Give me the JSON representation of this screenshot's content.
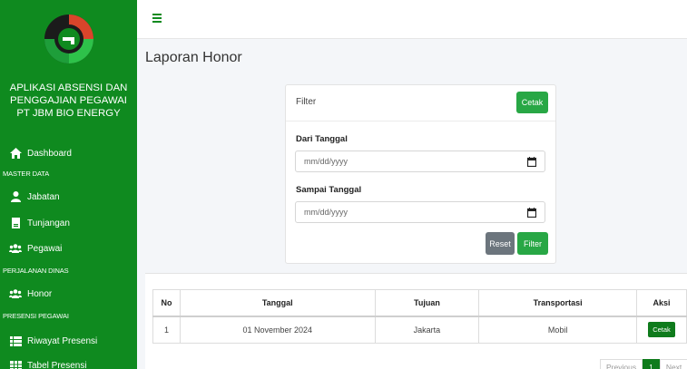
{
  "app": {
    "brand_lines": [
      "APLIKASI ABSENSI DAN",
      "PENGGAJIAN PEGAWAI",
      "PT JBM BIO ENERGY"
    ]
  },
  "sidebar": {
    "dashboard": "Dashboard",
    "section_master": "MASTER DATA",
    "jabatan": "Jabatan",
    "tunjangan": "Tunjangan",
    "pegawai": "Pegawai",
    "section_perjalanan": "PERJALANAN DINAS",
    "honor": "Honor",
    "section_presensi": "PRESENSI PEGAWAI",
    "riwayat": "Riwayat Presensi",
    "tabel": "Tabel Presensi"
  },
  "page": {
    "title": "Laporan Honor"
  },
  "filter_card": {
    "title": "Filter",
    "cetak_label": "Cetak",
    "dari_label": "Dari Tanggal",
    "dari_placeholder": "mm/dd/yyyy",
    "sampai_label": "Sampai Tanggal",
    "sampai_placeholder": "mm/dd/yyyy",
    "reset_label": "Reset",
    "filter_label": "Filter"
  },
  "table": {
    "headers": [
      "No",
      "Tanggal",
      "Tujuan",
      "Transportasi",
      "Aksi"
    ],
    "rows": [
      {
        "no": "1",
        "tanggal": "01 November 2024",
        "tujuan": "Jakarta",
        "transportasi": "Mobil",
        "aksi": "Cetak"
      }
    ]
  },
  "pagination": {
    "previous": "Previous",
    "page": "1",
    "next": "Next"
  },
  "colors": {
    "brand_green": "#0f8a1f",
    "button_green": "#28a745"
  },
  "icons": [
    "logo-icon",
    "home-icon",
    "user-icon",
    "document-icon",
    "users-icon",
    "list-icon",
    "table-icon",
    "calendar-icon",
    "menu-icon"
  ]
}
